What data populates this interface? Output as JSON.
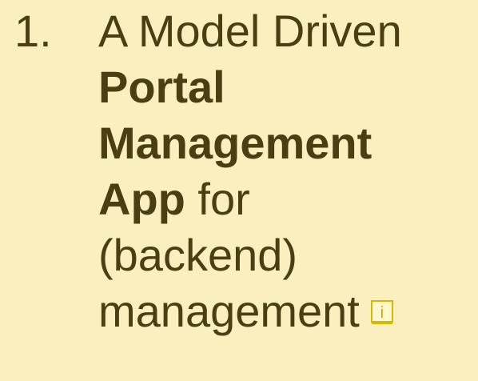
{
  "slide": {
    "list_number": "1.",
    "line1": "A Model Driven",
    "line2_bold": "Portal",
    "line3_bold": "Management",
    "line4_bold": "App",
    "line4_regular": " for",
    "line5": "(backend)",
    "line6": "management",
    "info_icon_glyph": "i",
    "icon_name": "info-icon",
    "colors": {
      "background": "#fbefc0",
      "text": "#4a3e12",
      "icon_border": "#d6b800"
    }
  }
}
